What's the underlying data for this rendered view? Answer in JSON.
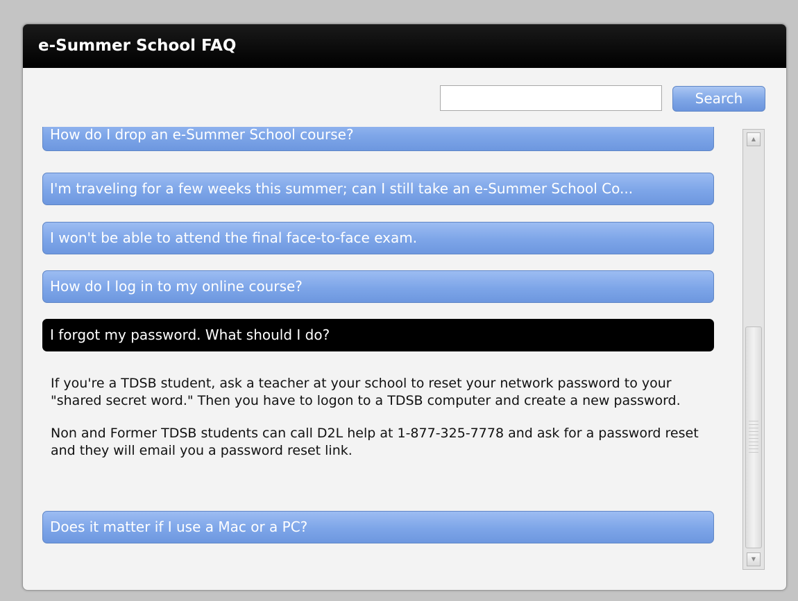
{
  "window": {
    "title": "e-Summer School FAQ"
  },
  "search": {
    "value": "",
    "placeholder": "",
    "button_label": "Search"
  },
  "faq": {
    "items": [
      {
        "question": "How do I drop an e-Summer School course?",
        "expanded": false
      },
      {
        "question": "I'm traveling for a few weeks this summer; can I still take an e-Summer School Co...",
        "expanded": false
      },
      {
        "question": "I won't be able to attend the final face-to-face exam.",
        "expanded": false
      },
      {
        "question": "How do I log in to my online course?",
        "expanded": false
      },
      {
        "question": "I forgot my password. What should I do?",
        "expanded": true
      },
      {
        "question": "Does it matter if I use a Mac or a PC?",
        "expanded": false
      }
    ],
    "answer": {
      "paragraphs": [
        "If you're a TDSB student, ask a teacher at your school to reset your network password to your \"shared secret word.\" Then you have to logon to a TDSB computer and create a new password.",
        "Non and Former TDSB students can call D2L help at 1-877-325-7778 and ask for a password reset and they will email you a password reset link."
      ]
    }
  },
  "scrollbar": {
    "up_icon": "triangle-up-icon",
    "down_icon": "triangle-down-icon"
  },
  "colors": {
    "accent_blue": "#7da5e8",
    "header_black": "#000000",
    "panel_bg": "#f3f3f3",
    "page_bg": "#c4c4c4"
  }
}
